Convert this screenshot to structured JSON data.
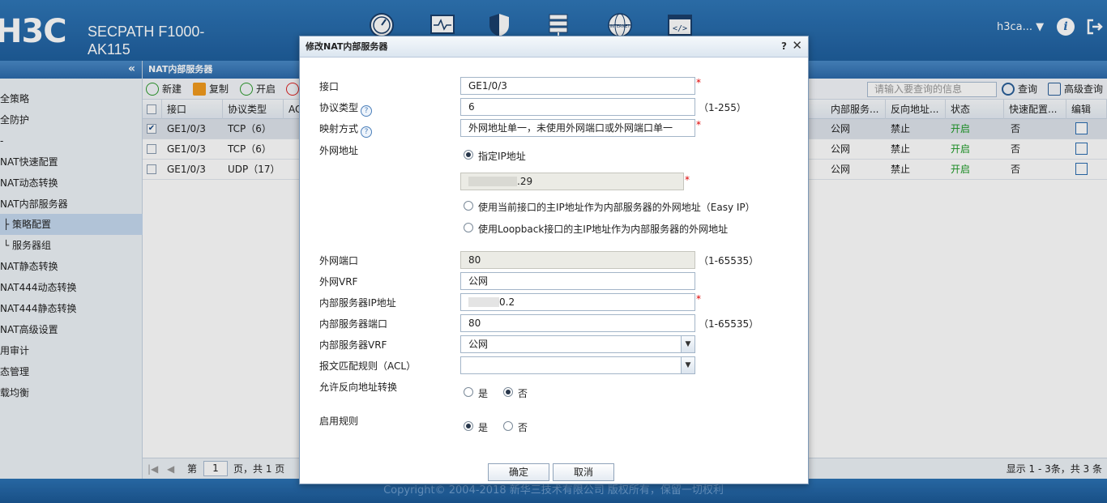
{
  "header": {
    "logo": "H3C",
    "product": "SECPATH F1000-AK115",
    "user": "h3ca... ▼",
    "nav_icons": [
      "dashboard-icon",
      "monitor-icon",
      "shield-icon",
      "server-icon",
      "internet-icon",
      "code-icon"
    ],
    "nav_internet_label": "INTERNET"
  },
  "sidebar": {
    "items": [
      {
        "label": "全策略"
      },
      {
        "label": "全防护"
      },
      {
        "label": "-"
      },
      {
        "label": "NAT快速配置"
      },
      {
        "label": "NAT动态转换"
      },
      {
        "label": "NAT内部服务器"
      },
      {
        "label": "├ 策略配置",
        "active": true
      },
      {
        "label": "└ 服务器组"
      },
      {
        "label": "NAT静态转换"
      },
      {
        "label": "NAT444动态转换"
      },
      {
        "label": "NAT444静态转换"
      },
      {
        "label": "NAT高级设置"
      },
      {
        "label": "用审计"
      },
      {
        "label": "态管理"
      },
      {
        "label": "载均衡"
      }
    ]
  },
  "main": {
    "title": "NAT内部服务器",
    "toolbar": {
      "new": "新建",
      "copy": "复制",
      "enable": "开启",
      "search_placeholder": "请输入要查询的信息",
      "search": "查询",
      "advanced": "高级查询"
    },
    "columns": {
      "iface": "接口",
      "proto": "协议类型",
      "acl": "AC",
      "inner": "内部服务...",
      "reverse": "反向地址...",
      "status": "状态",
      "fast": "快速配置...",
      "edit": "编辑"
    },
    "rows": [
      {
        "iface": "GE1/0/3",
        "proto": "TCP（6）",
        "inner": "公网",
        "reverse": "禁止",
        "status": "开启",
        "fast": "否",
        "checked": true
      },
      {
        "iface": "GE1/0/3",
        "proto": "TCP（6）",
        "inner": "公网",
        "reverse": "禁止",
        "status": "开启",
        "fast": "否",
        "checked": false
      },
      {
        "iface": "GE1/0/3",
        "proto": "UDP（17）",
        "inner": "公网",
        "reverse": "禁止",
        "status": "开启",
        "fast": "否",
        "checked": false
      }
    ],
    "pager": {
      "page_label": "第",
      "page": "1",
      "of": "页，共 1 页",
      "summary": "显示 1 - 3条，共 3 条"
    }
  },
  "footer": "Copyright© 2004-2018 新华三技术有限公司 版权所有，保留一切权利",
  "modal": {
    "title": "修改NAT内部服务器",
    "help": "?",
    "close": "✕",
    "fields": {
      "interface_label": "接口",
      "interface_value": "GE1/0/3",
      "protocol_label": "协议类型",
      "protocol_value": "6",
      "protocol_hint": "（1-255）",
      "mapping_label": "映射方式",
      "mapping_value": "外网地址单一，未使用外网端口或外网端口单一",
      "ext_addr_label": "外网地址",
      "ext_ip_option": "指定IP地址",
      "ext_ip_value": ".29",
      "easy_ip_option": "使用当前接口的主IP地址作为内部服务器的外网地址（Easy IP）",
      "loopback_option": "使用Loopback接口的主IP地址作为内部服务器的外网地址",
      "ext_port_label": "外网端口",
      "ext_port_value": "80",
      "ext_port_hint": "（1-65535）",
      "ext_vrf_label": "外网VRF",
      "ext_vrf_value": "公网",
      "inner_ip_label": "内部服务器IP地址",
      "inner_ip_value": "0.2",
      "inner_port_label": "内部服务器端口",
      "inner_port_value": "80",
      "inner_port_hint": "（1-65535）",
      "inner_vrf_label": "内部服务器VRF",
      "inner_vrf_value": "公网",
      "acl_label": "报文匹配规则（ACL）",
      "acl_value": "",
      "reverse_label": "允许反向地址转换",
      "yes": "是",
      "no": "否",
      "enable_label": "启用规则",
      "required": "*"
    },
    "ok": "确定",
    "cancel": "取消"
  }
}
